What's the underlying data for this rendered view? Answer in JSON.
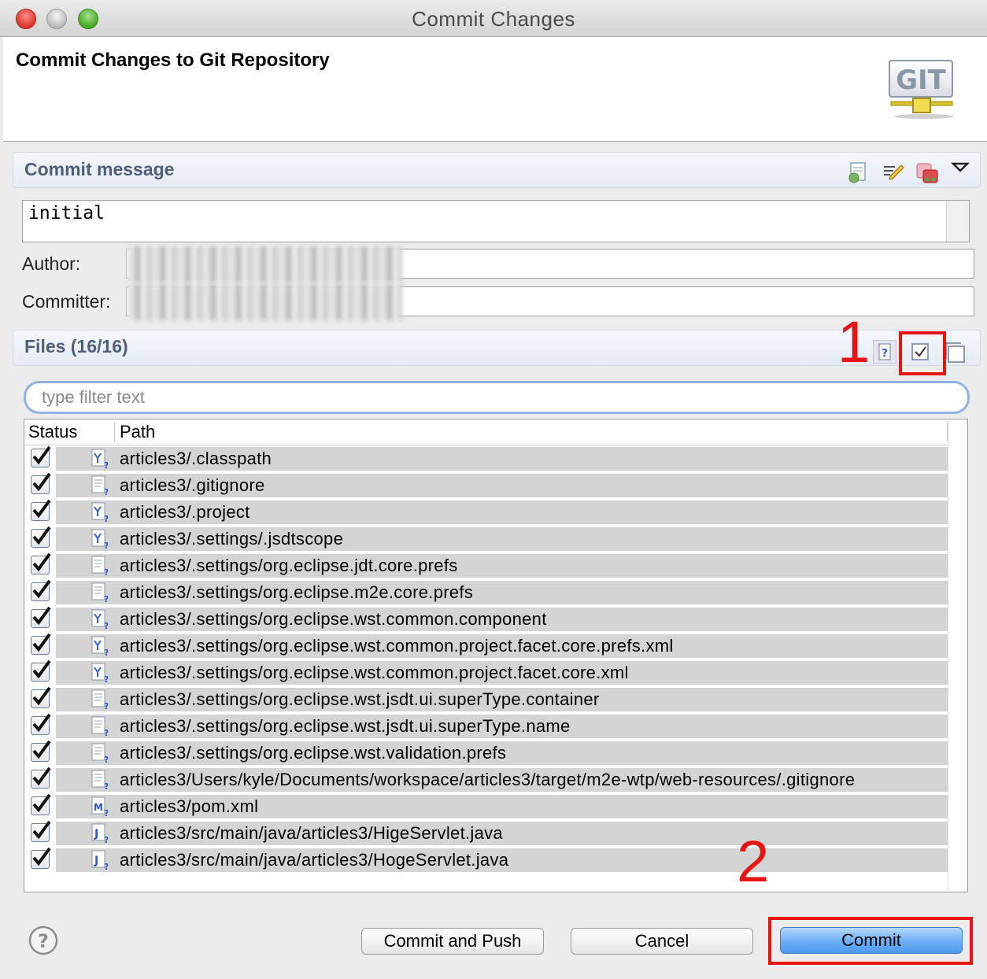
{
  "window": {
    "title": "Commit Changes"
  },
  "banner": {
    "title": "Commit Changes to Git Repository",
    "logo_icon": "git-logo-icon",
    "logo_text": "GIT"
  },
  "commit_message": {
    "header": "Commit message",
    "value": "initial",
    "tools": [
      "spell-check-icon",
      "edit-message-icon",
      "signed-off-icon",
      "dropdown-triangle-icon"
    ]
  },
  "author": {
    "label": "Author:",
    "value": ""
  },
  "committer": {
    "label": "Committer:",
    "value": ""
  },
  "files": {
    "header": "Files (16/16)",
    "tools": [
      "show-untracked-icon",
      "select-all-icon",
      "deselect-all-icon"
    ],
    "filter_placeholder": "type filter text",
    "columns": {
      "status": "Status",
      "path": "Path"
    },
    "rows": [
      {
        "path": "articles3/.classpath",
        "icon": "xml-file-icon",
        "checked": true
      },
      {
        "path": "articles3/.gitignore",
        "icon": "text-file-icon",
        "checked": true
      },
      {
        "path": "articles3/.project",
        "icon": "xml-file-icon",
        "checked": true
      },
      {
        "path": "articles3/.settings/.jsdtscope",
        "icon": "xml-file-icon",
        "checked": true
      },
      {
        "path": "articles3/.settings/org.eclipse.jdt.core.prefs",
        "icon": "text-file-icon",
        "checked": true
      },
      {
        "path": "articles3/.settings/org.eclipse.m2e.core.prefs",
        "icon": "text-file-icon",
        "checked": true
      },
      {
        "path": "articles3/.settings/org.eclipse.wst.common.component",
        "icon": "xml-file-icon",
        "checked": true
      },
      {
        "path": "articles3/.settings/org.eclipse.wst.common.project.facet.core.prefs.xml",
        "icon": "xml-file-icon",
        "checked": true
      },
      {
        "path": "articles3/.settings/org.eclipse.wst.common.project.facet.core.xml",
        "icon": "xml-file-icon",
        "checked": true
      },
      {
        "path": "articles3/.settings/org.eclipse.wst.jsdt.ui.superType.container",
        "icon": "text-file-icon",
        "checked": true
      },
      {
        "path": "articles3/.settings/org.eclipse.wst.jsdt.ui.superType.name",
        "icon": "text-file-icon",
        "checked": true
      },
      {
        "path": "articles3/.settings/org.eclipse.wst.validation.prefs",
        "icon": "text-file-icon",
        "checked": true
      },
      {
        "path": "articles3/Users/kyle/Documents/workspace/articles3/target/m2e-wtp/web-resources/.gitignore",
        "icon": "text-file-icon",
        "checked": true
      },
      {
        "path": "articles3/pom.xml",
        "icon": "maven-file-icon",
        "checked": true
      },
      {
        "path": "articles3/src/main/java/articles3/HigeServlet.java",
        "icon": "java-file-icon",
        "checked": true
      },
      {
        "path": "articles3/src/main/java/articles3/HogeServlet.java",
        "icon": "java-file-icon",
        "checked": true
      }
    ]
  },
  "annotations": {
    "mark1": "1",
    "mark2": "2"
  },
  "buttons": {
    "commit_and_push": "Commit and Push",
    "cancel": "Cancel",
    "commit": "Commit"
  },
  "colors": {
    "accent_blue": "#4f9bf0",
    "annotation_red": "#e81313",
    "section_header_text": "#4f5f78"
  }
}
